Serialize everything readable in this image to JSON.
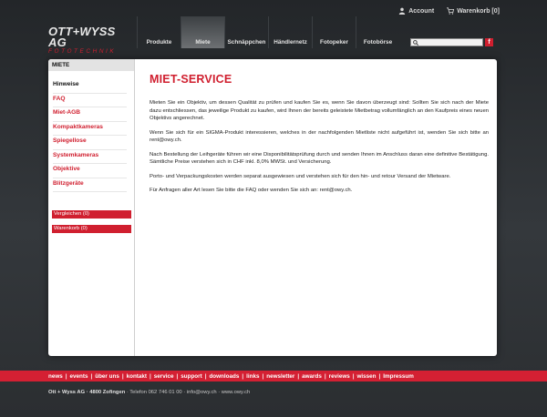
{
  "topbar": {
    "account": "Account",
    "cart": "Warenkorb [0]"
  },
  "logo": {
    "line1": "OTT+WYSS AG",
    "line2": "FOTOTECHNIK"
  },
  "nav": [
    "Produkte",
    "Miete",
    "Schnäppchen",
    "Händlernetz",
    "Fotopeker",
    "Fotobörse"
  ],
  "nav_active": "Miete",
  "search": {
    "value": "",
    "placeholder": ""
  },
  "facebook_label": "f",
  "sidebar": {
    "heading": "MIETE",
    "items": [
      "Hinweise",
      "FAQ",
      "Miet-AGB",
      "Kompaktkameras",
      "Spiegellose",
      "Systemkameras",
      "Objektive",
      "Blitzgeräte"
    ],
    "current": "Hinweise",
    "compare": "Vergleichen (0)",
    "cart": "Warenkorb (0)"
  },
  "content": {
    "title": "MIET-SERVICE",
    "p1": "Mieten Sie ein Objektiv, um dessen Qualität zu prüfen und kaufen Sie es, wenn Sie davon überzeugt sind: Sollten Sie sich nach der Miete dazu entschliessen, das jeweilige Produkt zu kaufen, wird Ihnen der bereits geleistete Mietbetrag vollumfänglich an den Kaufpreis eines neuen Objektivs angerechnet.",
    "p2": "Wenn Sie sich für ein SIGMA-Produkt interessieren, welches in der nachfolgenden Mietliste nicht aufgeführt ist, wenden Sie sich bitte an rent@owy.ch.",
    "p3": "Nach Bestellung der Leihgeräte führen wir eine Disponibilitätsprüfung durch und senden Ihnen im Anschluss daran eine definitive Bestätigung. Sämtliche Preise verstehen sich in CHF inkl. 8,0% MWSt. und Versicherung.",
    "p4": "Porto- und Verpackungskosten werden separat ausgewiesen und verstehen sich für den hin- und retour Versand der Mietware.",
    "p5": "Für Anfragen aller Art lesen Sie bitte die FAQ oder wenden Sie sich an: rent@owy.ch."
  },
  "footer": {
    "links": [
      "news",
      "events",
      "über uns",
      "kontakt",
      "service",
      "support",
      "downloads",
      "links",
      "newsletter",
      "awards",
      "reviews",
      "wissen",
      "Impressum"
    ],
    "company": "Ott + Wyss AG · 4800 Zofingen",
    "contact": " · Telefon 062 746 01 00 · info@owy.ch · www.owy.ch"
  },
  "colors": {
    "accent": "#d01f2f",
    "background": "#2b2e31",
    "panel": "#ffffff"
  }
}
